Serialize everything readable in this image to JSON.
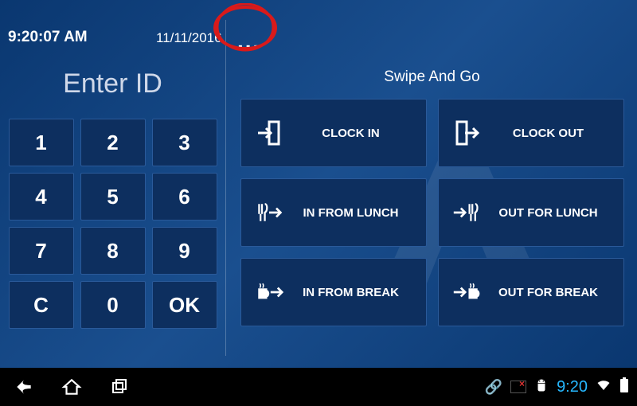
{
  "header": {
    "time": "9:20:07 AM",
    "date": "11/11/2016",
    "more_label": "..."
  },
  "left": {
    "title": "Enter ID",
    "keys": [
      "1",
      "2",
      "3",
      "4",
      "5",
      "6",
      "7",
      "8",
      "9",
      "C",
      "0",
      "OK"
    ]
  },
  "right": {
    "title": "Swipe And Go",
    "actions": [
      {
        "id": "clock-in",
        "label": "CLOCK IN",
        "icon": "enter-door"
      },
      {
        "id": "clock-out",
        "label": "CLOCK OUT",
        "icon": "exit-door"
      },
      {
        "id": "in-from-lunch",
        "label": "IN FROM LUNCH",
        "icon": "lunch-in"
      },
      {
        "id": "out-for-lunch",
        "label": "OUT FOR LUNCH",
        "icon": "lunch-out"
      },
      {
        "id": "in-from-break",
        "label": "IN FROM BREAK",
        "icon": "break-in"
      },
      {
        "id": "out-for-break",
        "label": "OUT FOR BREAK",
        "icon": "break-out"
      }
    ]
  },
  "navbar": {
    "clock": "9:20"
  },
  "colors": {
    "bg_dark": "#0d2f5f",
    "border": "#2a5a9a",
    "accent": "#26b8ff",
    "anno_red": "#d91a1a"
  }
}
